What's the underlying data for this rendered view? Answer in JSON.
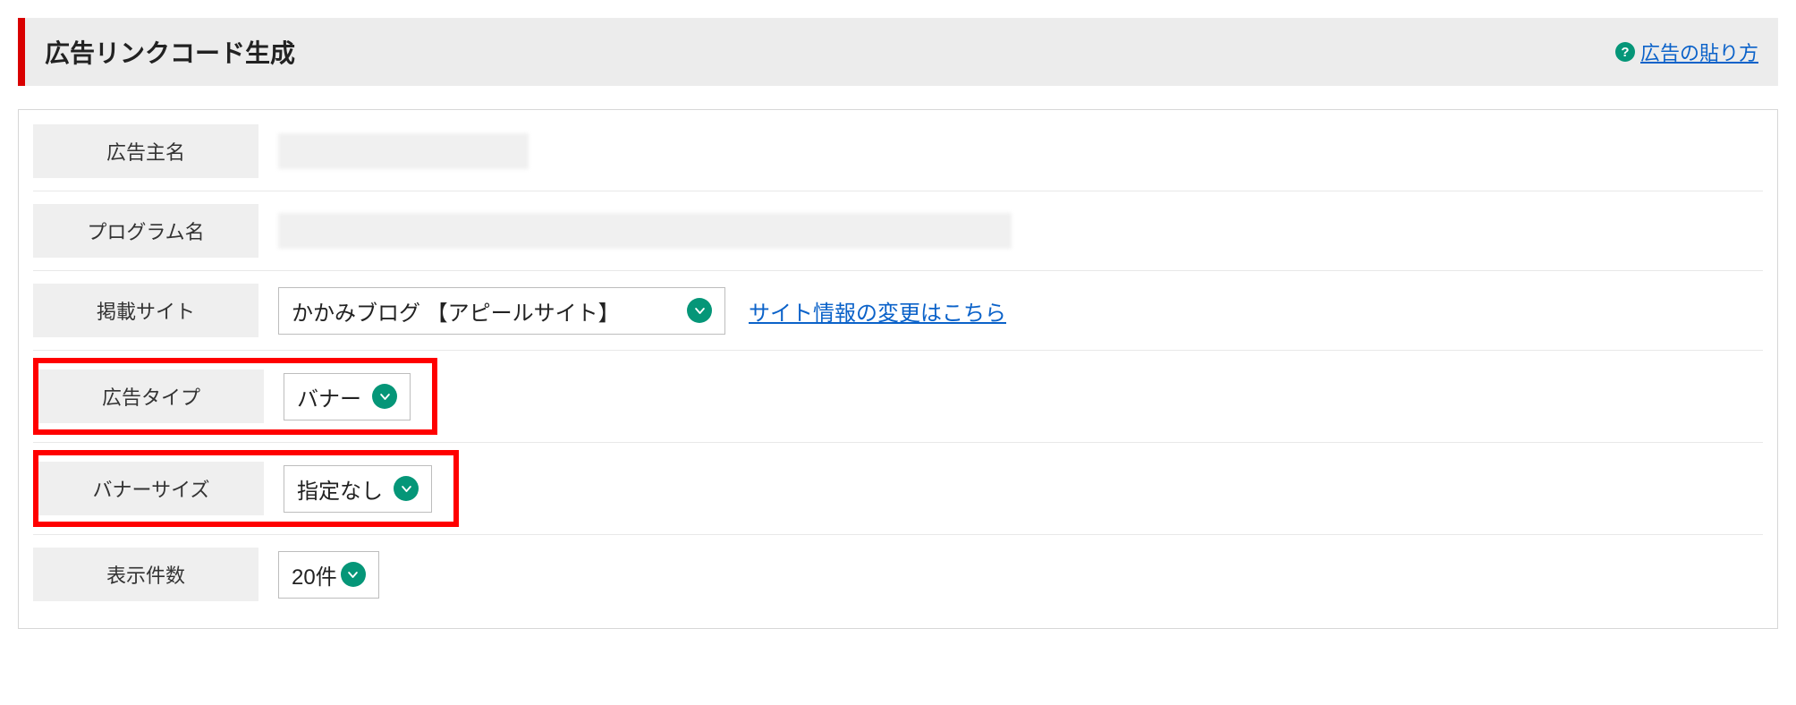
{
  "header": {
    "title": "広告リンクコード生成",
    "help_link": "広告の貼り方"
  },
  "rows": {
    "advertiser_label": "広告主名",
    "program_label": "プログラム名",
    "site_label": "掲載サイト",
    "site_select_value": "かかみブログ 【アピールサイト】",
    "site_change_link": "サイト情報の変更はこちら",
    "adtype_label": "広告タイプ",
    "adtype_value": "バナー",
    "bannersize_label": "バナーサイズ",
    "bannersize_value": "指定なし",
    "count_label": "表示件数",
    "count_value": "20件"
  }
}
